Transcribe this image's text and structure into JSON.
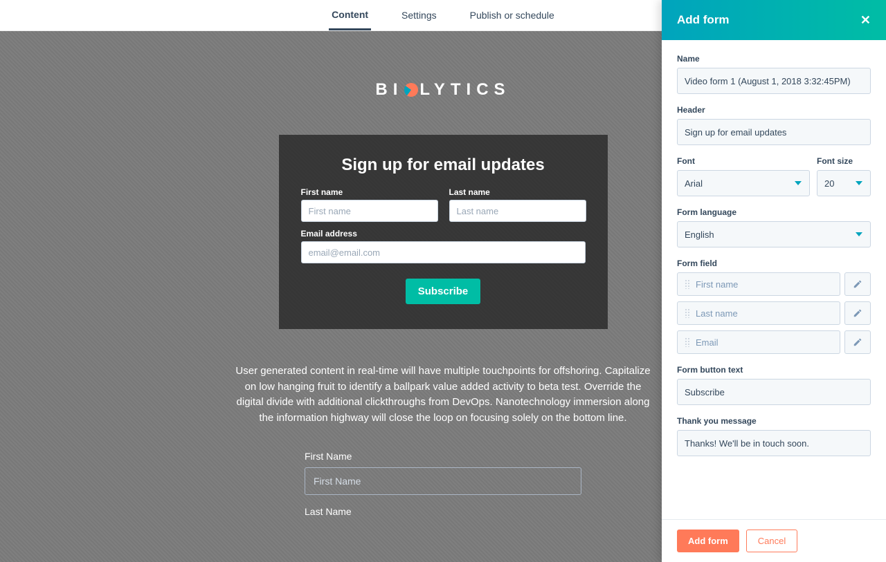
{
  "tabs": {
    "content": "Content",
    "settings": "Settings",
    "publish": "Publish or schedule"
  },
  "logo": {
    "text_a": "BI",
    "text_b": "LYTICS"
  },
  "preview_form": {
    "heading": "Sign up for email updates",
    "first_name_label": "First name",
    "first_name_placeholder": "First name",
    "last_name_label": "Last name",
    "last_name_placeholder": "Last name",
    "email_label": "Email address",
    "email_placeholder": "email@email.com",
    "subscribe": "Subscribe"
  },
  "blurb": "User generated content in real-time will have multiple touchpoints for offshoring. Capitalize on low hanging fruit to identify a ballpark value added activity to beta test. Override the digital divide with additional clickthroughs from DevOps. Nanotechnology immersion along the information highway will close the loop on focusing solely on the bottom line.",
  "lower_form": {
    "first_label": "First Name",
    "first_placeholder": "First Name",
    "last_label": "Last Name"
  },
  "panel": {
    "title": "Add form",
    "name_label": "Name",
    "name_value": "Video form 1 (August 1, 2018 3:32:45PM)",
    "header_label": "Header",
    "header_value": "Sign up for email updates",
    "font_label": "Font",
    "font_value": "Arial",
    "font_size_label": "Font size",
    "font_size_value": "20",
    "lang_label": "Form language",
    "lang_value": "English",
    "ff_label": "Form field",
    "ff_items": [
      "First name",
      "Last name",
      "Email"
    ],
    "btn_text_label": "Form button text",
    "btn_text_value": "Subscribe",
    "thanks_label": "Thank you message",
    "thanks_value": "Thanks! We'll be in touch soon.",
    "add_btn": "Add form",
    "cancel_btn": "Cancel"
  }
}
